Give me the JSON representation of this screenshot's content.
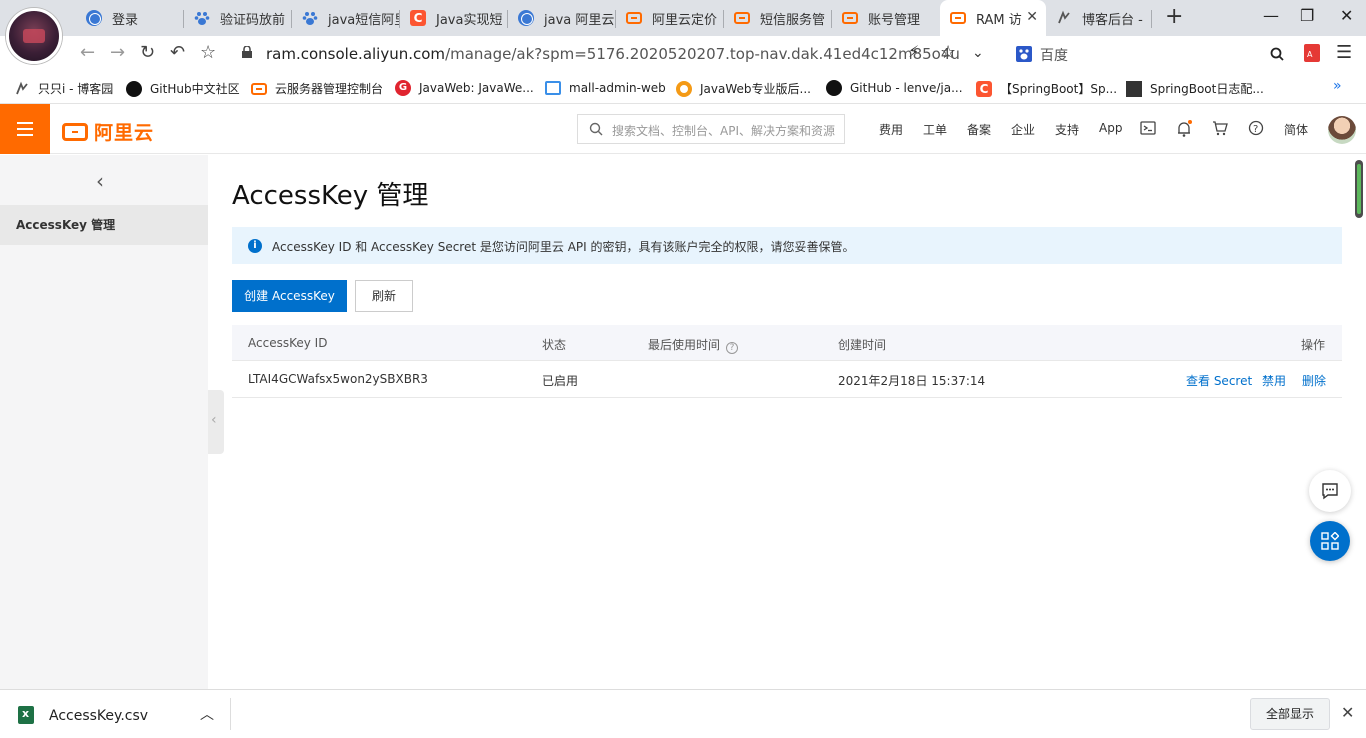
{
  "browser": {
    "tabs": [
      {
        "label": "登录",
        "icon": "globe-icon"
      },
      {
        "label": "验证码放前",
        "icon": "baidu-paw-icon"
      },
      {
        "label": "java短信阿里",
        "icon": "baidu-paw-icon"
      },
      {
        "label": "Java实现短",
        "icon": "csdn-icon"
      },
      {
        "label": "java 阿里云",
        "icon": "globe-icon"
      },
      {
        "label": "阿里云定价",
        "icon": "aliyun-icon"
      },
      {
        "label": "短信服务管",
        "icon": "aliyun-icon"
      },
      {
        "label": "账号管理",
        "icon": "aliyun-icon"
      },
      {
        "label": "RAM 访",
        "icon": "aliyun-icon"
      },
      {
        "label": "博客后台 -",
        "icon": "cnblogs-icon"
      }
    ],
    "new_tab": "+",
    "url_host": "ram.console.aliyun.com",
    "url_path": "/manage/ak?spm=5176.2020520207.top-nav.dak.41ed4c12m85o4u",
    "search_engine_label": "百度",
    "bookmarks": [
      {
        "label": "只只i - 博客园",
        "icon": "cnblogs-icon"
      },
      {
        "label": "GitHub中文社区",
        "icon": "github-icon"
      },
      {
        "label": "云服务器管理控制台",
        "icon": "aliyun-icon"
      },
      {
        "label": "JavaWeb: JavaWe...",
        "icon": "gitee-icon"
      },
      {
        "label": "mall-admin-web",
        "icon": "shop-icon"
      },
      {
        "label": "JavaWeb专业版后...",
        "icon": "orange-circle-icon"
      },
      {
        "label": "GitHub - lenve/ja...",
        "icon": "github-icon"
      },
      {
        "label": "【SpringBoot】Sp...",
        "icon": "csdn-icon"
      },
      {
        "label": "SpringBoot日志配...",
        "icon": "photo-icon"
      }
    ],
    "bookmarks_overflow": "»"
  },
  "console": {
    "logo_text": "阿里云",
    "search_placeholder": "搜索文档、控制台、API、解决方案和资源",
    "nav": [
      "费用",
      "工单",
      "备案",
      "企业",
      "支持",
      "App"
    ],
    "language": "简体"
  },
  "sidebar": {
    "back": "‹",
    "items": [
      {
        "label": "AccessKey 管理"
      }
    ]
  },
  "main": {
    "title": "AccessKey 管理",
    "notice": "AccessKey ID 和 AccessKey Secret 是您访问阿里云 API 的密钥，具有该账户完全的权限，请您妥善保管。",
    "create_button": "创建 AccessKey",
    "refresh_button": "刷新",
    "table": {
      "headers": {
        "id": "AccessKey ID",
        "status": "状态",
        "last_used": "最后使用时间",
        "created": "创建时间",
        "actions": "操作"
      },
      "rows": [
        {
          "id": "LTAI4GCWafsx5won2ySBXBR3",
          "status": "已启用",
          "last_used": "",
          "created": "2021年2月18日 15:37:14",
          "actions": [
            "查看 Secret",
            "禁用",
            "删除"
          ]
        }
      ]
    }
  },
  "download_shelf": {
    "filename": "AccessKey.csv",
    "show_all": "全部显示",
    "close": "✕"
  },
  "colors": {
    "brand_orange": "#ff6a00",
    "primary_blue": "#0070cc",
    "notice_bg": "#e8f4fd"
  }
}
